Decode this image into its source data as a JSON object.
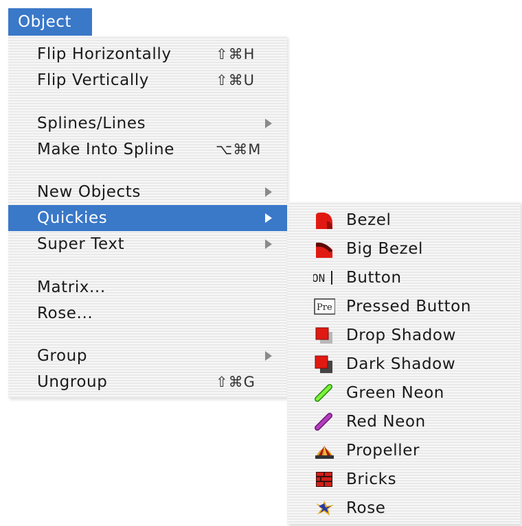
{
  "menubar": {
    "title": "Object"
  },
  "menu": {
    "items": [
      {
        "label": "Flip Horizontally",
        "shortcut": "⇧⌘H"
      },
      {
        "label": "Flip Vertically",
        "shortcut": "⇧⌘U"
      },
      {
        "label": "Splines/Lines",
        "submenu": true
      },
      {
        "label": "Make Into Spline",
        "shortcut": "⌥⌘M"
      },
      {
        "label": "New Objects",
        "submenu": true
      },
      {
        "label": "Quickies",
        "submenu": true,
        "selected": true
      },
      {
        "label": "Super Text",
        "submenu": true
      },
      {
        "label": "Matrix..."
      },
      {
        "label": "Rose..."
      },
      {
        "label": "Group",
        "submenu": true
      },
      {
        "label": "Ungroup",
        "shortcut": "⇧⌘G"
      }
    ]
  },
  "submenu": {
    "items": [
      {
        "label": "Bezel",
        "icon": "bezel-icon"
      },
      {
        "label": "Big Bezel",
        "icon": "big-bezel-icon"
      },
      {
        "label": "Button",
        "icon": "button-icon",
        "icon_text": "ON"
      },
      {
        "label": "Pressed Button",
        "icon": "pressed-button-icon",
        "icon_text": "Pre"
      },
      {
        "label": "Drop Shadow",
        "icon": "drop-shadow-icon"
      },
      {
        "label": "Dark Shadow",
        "icon": "dark-shadow-icon"
      },
      {
        "label": "Green Neon",
        "icon": "green-neon-icon"
      },
      {
        "label": "Red Neon",
        "icon": "red-neon-icon"
      },
      {
        "label": "Propeller",
        "icon": "propeller-icon"
      },
      {
        "label": "Bricks",
        "icon": "bricks-icon"
      },
      {
        "label": "Rose",
        "icon": "rose-icon"
      }
    ]
  },
  "colors": {
    "selection": "#3a78c8",
    "icon_red": "#e01a12"
  }
}
